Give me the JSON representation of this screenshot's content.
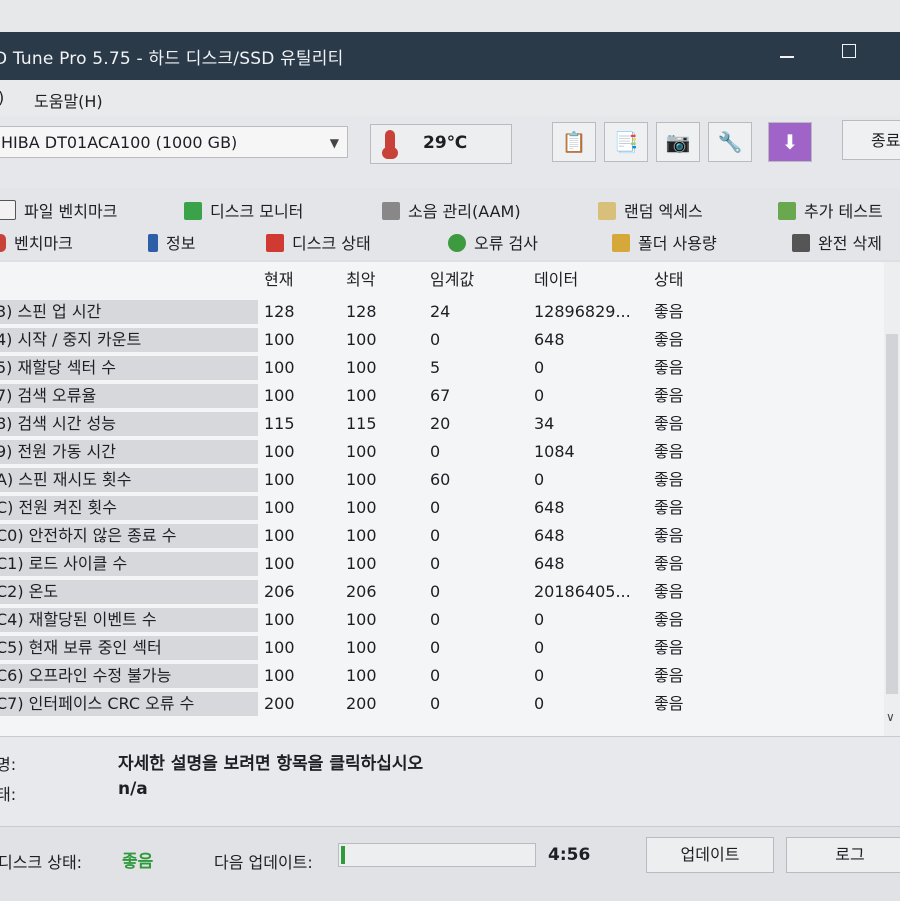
{
  "window": {
    "title": "D Tune Pro 5.75 - 하드 디스크/SSD 유틸리티"
  },
  "menu": {
    "item1": ")",
    "item2": "도움말(H)"
  },
  "toolbar": {
    "drive": "HIBA DT01ACA100 (1000 GB)",
    "temperature": "29℃",
    "exit": "종료"
  },
  "tabs": {
    "row1": [
      "파일 벤치마크",
      "디스크 모니터",
      "소음 관리(AAM)",
      "랜덤 엑세스",
      "추가 테스트"
    ],
    "row2": [
      "벤치마크",
      "정보",
      "디스크 상태",
      "오류 검사",
      "폴더 사용량",
      "완전 삭제"
    ]
  },
  "table": {
    "headers": [
      "현재",
      "최악",
      "임계값",
      "데이터",
      "상태"
    ],
    "rows": [
      {
        "name": "3) 스핀 업 시간",
        "current": "128",
        "worst": "128",
        "threshold": "24",
        "data": "12896829...",
        "status": "좋음"
      },
      {
        "name": "4) 시작 / 중지 카운트",
        "current": "100",
        "worst": "100",
        "threshold": "0",
        "data": "648",
        "status": "좋음"
      },
      {
        "name": "5) 재할당 섹터 수",
        "current": "100",
        "worst": "100",
        "threshold": "5",
        "data": "0",
        "status": "좋음"
      },
      {
        "name": "7) 검색 오류율",
        "current": "100",
        "worst": "100",
        "threshold": "67",
        "data": "0",
        "status": "좋음"
      },
      {
        "name": "8) 검색 시간 성능",
        "current": "115",
        "worst": "115",
        "threshold": "20",
        "data": "34",
        "status": "좋음"
      },
      {
        "name": "9) 전원 가동 시간",
        "current": "100",
        "worst": "100",
        "threshold": "0",
        "data": "1084",
        "status": "좋음"
      },
      {
        "name": "A) 스핀 재시도 횟수",
        "current": "100",
        "worst": "100",
        "threshold": "60",
        "data": "0",
        "status": "좋음"
      },
      {
        "name": "C) 전원 켜진 횟수",
        "current": "100",
        "worst": "100",
        "threshold": "0",
        "data": "648",
        "status": "좋음"
      },
      {
        "name": "C0) 안전하지 않은 종료 수",
        "current": "100",
        "worst": "100",
        "threshold": "0",
        "data": "648",
        "status": "좋음"
      },
      {
        "name": "C1) 로드 사이클 수",
        "current": "100",
        "worst": "100",
        "threshold": "0",
        "data": "648",
        "status": "좋음"
      },
      {
        "name": "C2) 온도",
        "current": "206",
        "worst": "206",
        "threshold": "0",
        "data": "20186405...",
        "status": "좋음"
      },
      {
        "name": "C4) 재할당된 이벤트 수",
        "current": "100",
        "worst": "100",
        "threshold": "0",
        "data": "0",
        "status": "좋음"
      },
      {
        "name": "C5) 현재 보류 중인 섹터",
        "current": "100",
        "worst": "100",
        "threshold": "0",
        "data": "0",
        "status": "좋음"
      },
      {
        "name": "C6) 오프라인 수정 불가능",
        "current": "100",
        "worst": "100",
        "threshold": "0",
        "data": "0",
        "status": "좋음"
      },
      {
        "name": "C7) 인터페이스 CRC 오류 수",
        "current": "200",
        "worst": "200",
        "threshold": "0",
        "data": "0",
        "status": "좋음"
      }
    ]
  },
  "description": {
    "label1": "명:",
    "value1": "자세한 설명을 보려면 항목을 클릭하십시오",
    "label2": "태:",
    "value2": "n/a"
  },
  "statusbar": {
    "disk_status_label": "디스크 상태:",
    "disk_status_value": "좋음",
    "next_update_label": "다음 업데이트:",
    "timer": "4:56",
    "update_button": "업데이트",
    "log_button": "로그"
  },
  "icons": [
    "thermometer-icon",
    "copy-icon",
    "copy-info-icon",
    "camera-icon",
    "wrench-icon",
    "download-icon"
  ]
}
